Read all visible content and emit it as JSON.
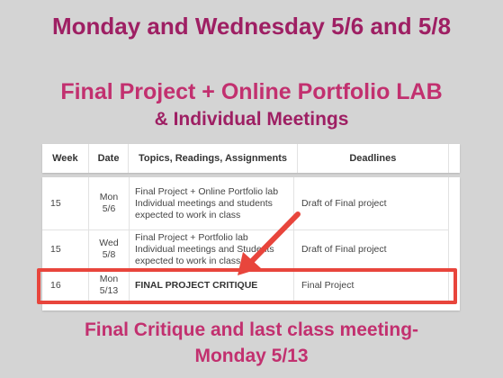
{
  "slide": {
    "title": "Monday and Wednesday 5/6 and 5/8",
    "subtitle_line1": "Final Project + Online Portfolio LAB",
    "subtitle_line2": "& Individual Meetings",
    "footer_line1": "Final Critique and last class meeting-",
    "footer_line2": "Monday 5/13"
  },
  "table": {
    "headers": [
      "Week",
      "Date",
      "Topics, Readings, Assignments",
      "Deadlines"
    ],
    "rows": [
      {
        "week": "15",
        "date": "Mon\n5/6",
        "topic": "Final Project + Online Portfolio lab\nIndividual meetings and students\nexpected to work in class",
        "deadline": "Draft of Final project"
      },
      {
        "week": "15",
        "date": "Wed\n5/8",
        "topic": "Final Project + Portfolio lab\nIndividual meetings and Students\nexpected to work in class",
        "deadline": "Draft of Final project"
      },
      {
        "week": "16",
        "date": "Mon\n5/13",
        "topic": "FINAL PROJECT CRITIQUE",
        "deadline": "Final Project"
      }
    ]
  },
  "colors": {
    "title": "#9e1f63",
    "accent": "#c2306f",
    "highlight": "#e8453c",
    "background": "#d4d4d4"
  },
  "icons": [
    "arrow-annotation-icon"
  ]
}
